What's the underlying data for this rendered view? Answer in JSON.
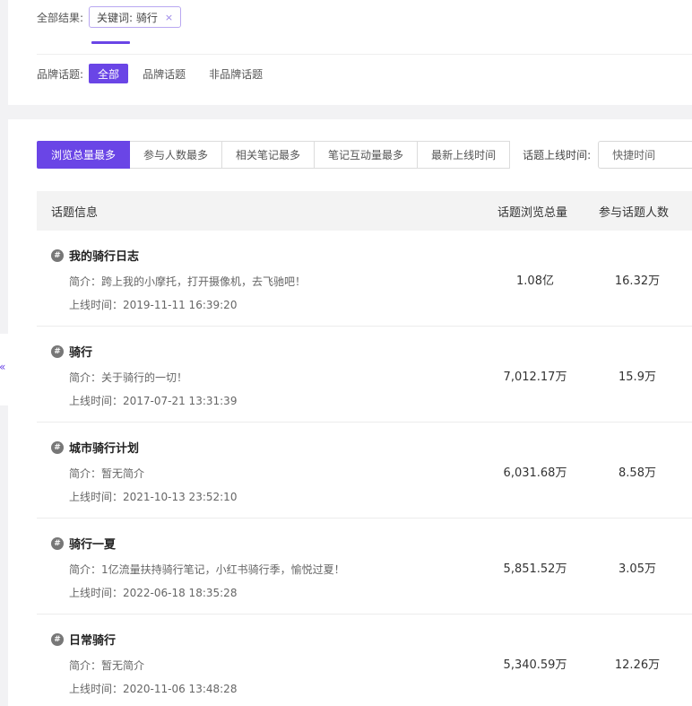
{
  "filters": {
    "all_results_label": "全部结果:",
    "keyword_tag": "关键词: 骑行",
    "keyword_remove": "×",
    "brand_topic_label": "品牌话题:",
    "brand_options": [
      "全部",
      "品牌话题",
      "非品牌话题"
    ],
    "brand_selected": "全部"
  },
  "edge_handle": "«",
  "sort": {
    "tabs": [
      "浏览总量最多",
      "参与人数最多",
      "相关笔记最多",
      "笔记互动量最多",
      "最新上线时间"
    ],
    "active": "浏览总量最多",
    "date_label": "话题上线时间:",
    "date_placeholder": "快捷时间"
  },
  "table": {
    "headers": {
      "info": "话题信息",
      "views": "话题浏览总量",
      "participants": "参与话题人数"
    },
    "hash_icon": "#",
    "rows": [
      {
        "title": "我的骑行日志",
        "desc": "简介：跨上我的小摩托，打开摄像机，去飞驰吧！",
        "time": "上线时间：2019-11-11 16:39:20",
        "views": "1.08亿",
        "participants": "16.32万"
      },
      {
        "title": "骑行",
        "desc": "简介：关于骑行的一切！",
        "time": "上线时间：2017-07-21 13:31:39",
        "views": "7,012.17万",
        "participants": "15.9万"
      },
      {
        "title": "城市骑行计划",
        "desc": "简介：暂无简介",
        "time": "上线时间：2021-10-13 23:52:10",
        "views": "6,031.68万",
        "participants": "8.58万"
      },
      {
        "title": "骑行一夏",
        "desc": "简介：1亿流量扶持骑行笔记，小红书骑行季，愉悦过夏！",
        "time": "上线时间：2022-06-18 18:35:28",
        "views": "5,851.52万",
        "participants": "3.05万"
      },
      {
        "title": "日常骑行",
        "desc": "简介：暂无简介",
        "time": "上线时间：2020-11-06 13:48:28",
        "views": "5,340.59万",
        "participants": "12.26万"
      }
    ]
  },
  "colors": {
    "accent": "#6a45e6",
    "page_bg": "#f2f2f4",
    "header_bg": "#f3f3f3"
  }
}
